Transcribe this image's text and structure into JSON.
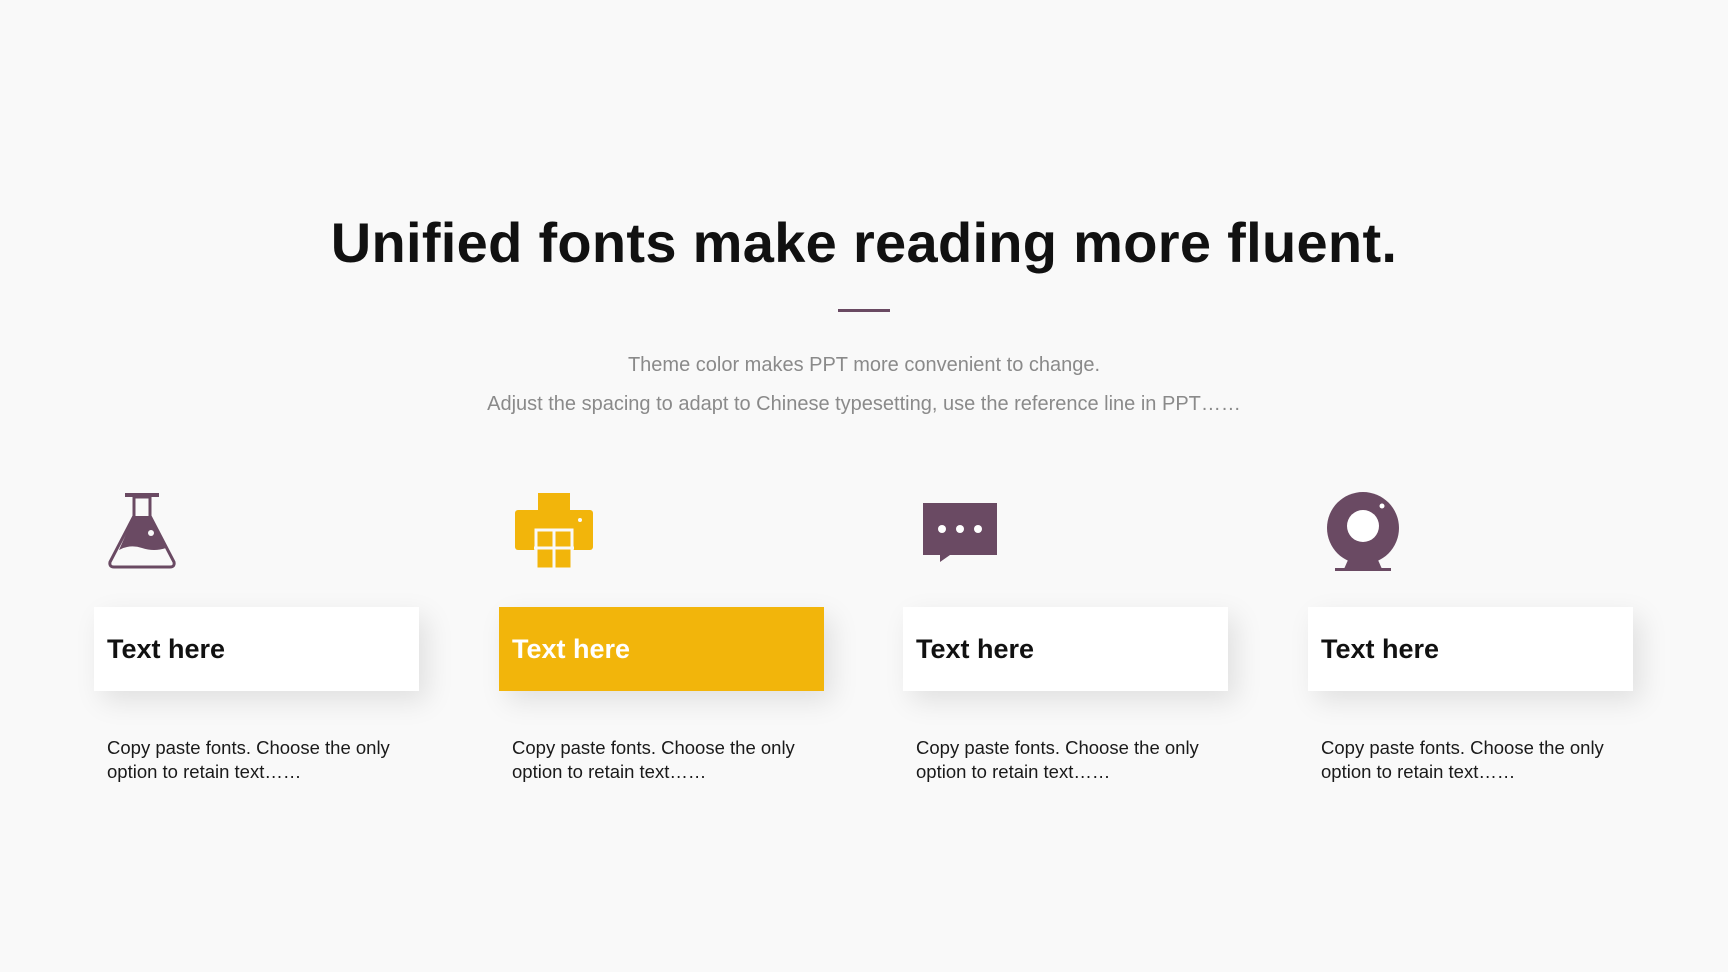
{
  "title": "Unified fonts make reading more fluent.",
  "subtitle_line1": "Theme color makes PPT more convenient to change.",
  "subtitle_line2": "Adjust the spacing to adapt to Chinese typesetting, use the reference line in PPT……",
  "colors": {
    "primary": "#6a4a63",
    "accent": "#f2b50b",
    "background": "#f9f9f9"
  },
  "features": [
    {
      "icon": "flask-icon",
      "label": "Text here",
      "description": "Copy paste fonts. Choose the only option to retain text……"
    },
    {
      "icon": "printer-icon",
      "label": "Text here",
      "description": "Copy paste fonts. Choose the only option to retain text……"
    },
    {
      "icon": "chat-bubble-icon",
      "label": "Text here",
      "description": "Copy paste fonts. Choose the only option to retain text……"
    },
    {
      "icon": "webcam-icon",
      "label": "Text here",
      "description": "Copy paste fonts. Choose the only option to retain text……"
    }
  ]
}
